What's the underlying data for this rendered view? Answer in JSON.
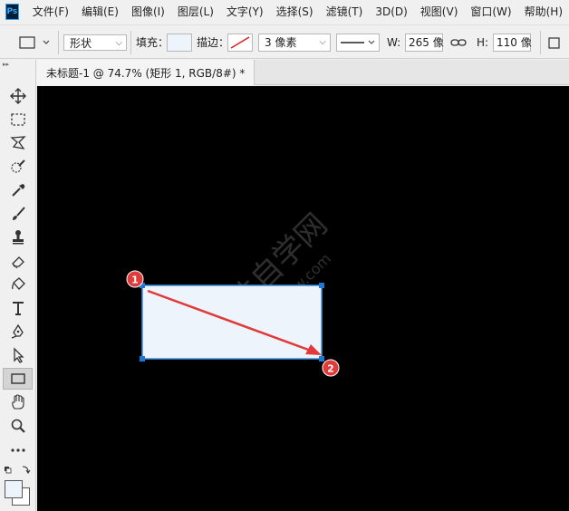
{
  "app": {
    "logo_text": "Ps"
  },
  "menu": {
    "items": [
      "文件(F)",
      "编辑(E)",
      "图像(I)",
      "图层(L)",
      "文字(Y)",
      "选择(S)",
      "滤镜(T)",
      "3D(D)",
      "视图(V)",
      "窗口(W)",
      "帮助(H)"
    ]
  },
  "options": {
    "mode_value": "形状",
    "fill_label": "填充：",
    "stroke_label": "描边：",
    "stroke_width_value": "3 像素",
    "width_label": "W:",
    "width_value": "265 像",
    "height_label": "H:",
    "height_value": "110 像",
    "fill_color": "#eef4fb"
  },
  "document": {
    "tab_title": "未标题-1 @ 74.7% (矩形 1, RGB/8#) *"
  },
  "annotations": {
    "marker_1": "1",
    "marker_2": "2",
    "marker_color": "#e03a3a"
  },
  "watermark": {
    "text": "软件自学网",
    "url": "www.rjzxw.com"
  },
  "shape": {
    "fill": "#eef4fb",
    "stroke": "#3d8fe0"
  }
}
